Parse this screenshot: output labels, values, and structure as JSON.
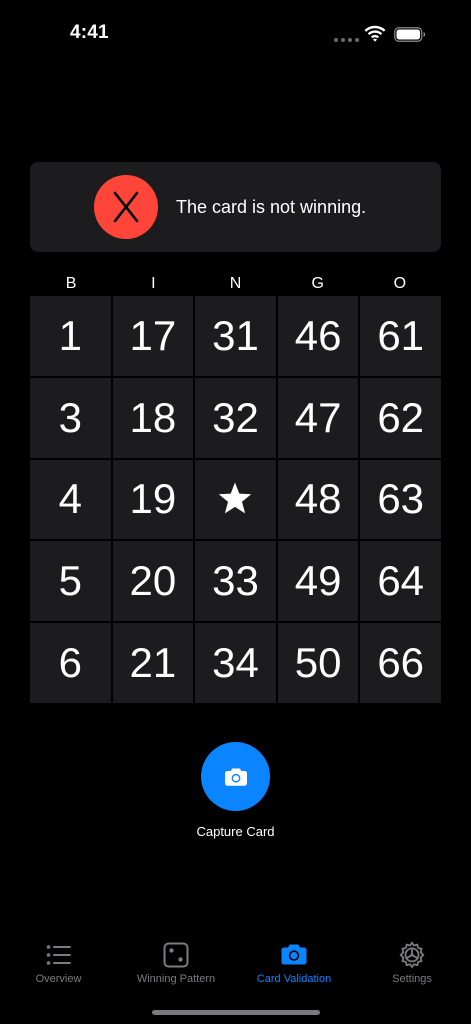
{
  "status_bar": {
    "time": "4:41"
  },
  "result": {
    "message": "The card is not winning.",
    "icon": "x-icon",
    "badge_color": "#ff453a"
  },
  "bingo": {
    "letters": [
      "B",
      "I",
      "N",
      "G",
      "O"
    ],
    "rows": [
      [
        "1",
        "17",
        "31",
        "46",
        "61"
      ],
      [
        "3",
        "18",
        "32",
        "47",
        "62"
      ],
      [
        "4",
        "19",
        "",
        "48",
        "63"
      ],
      [
        "5",
        "20",
        "33",
        "49",
        "64"
      ],
      [
        "6",
        "21",
        "34",
        "50",
        "66"
      ]
    ],
    "free_cell_icon": "star-icon"
  },
  "capture": {
    "label": "Capture Card",
    "icon": "camera-icon",
    "color": "#0a84ff"
  },
  "tabs": [
    {
      "label": "Overview",
      "icon": "list-icon",
      "active": false
    },
    {
      "label": "Winning Pattern",
      "icon": "dice-icon",
      "active": false
    },
    {
      "label": "Card Validation",
      "icon": "camera-icon",
      "active": true
    },
    {
      "label": "Settings",
      "icon": "gear-icon",
      "active": false
    }
  ],
  "colors": {
    "accent": "#0a84ff",
    "inactive": "#7c7c80",
    "cell_background": "#1c1c1e"
  }
}
